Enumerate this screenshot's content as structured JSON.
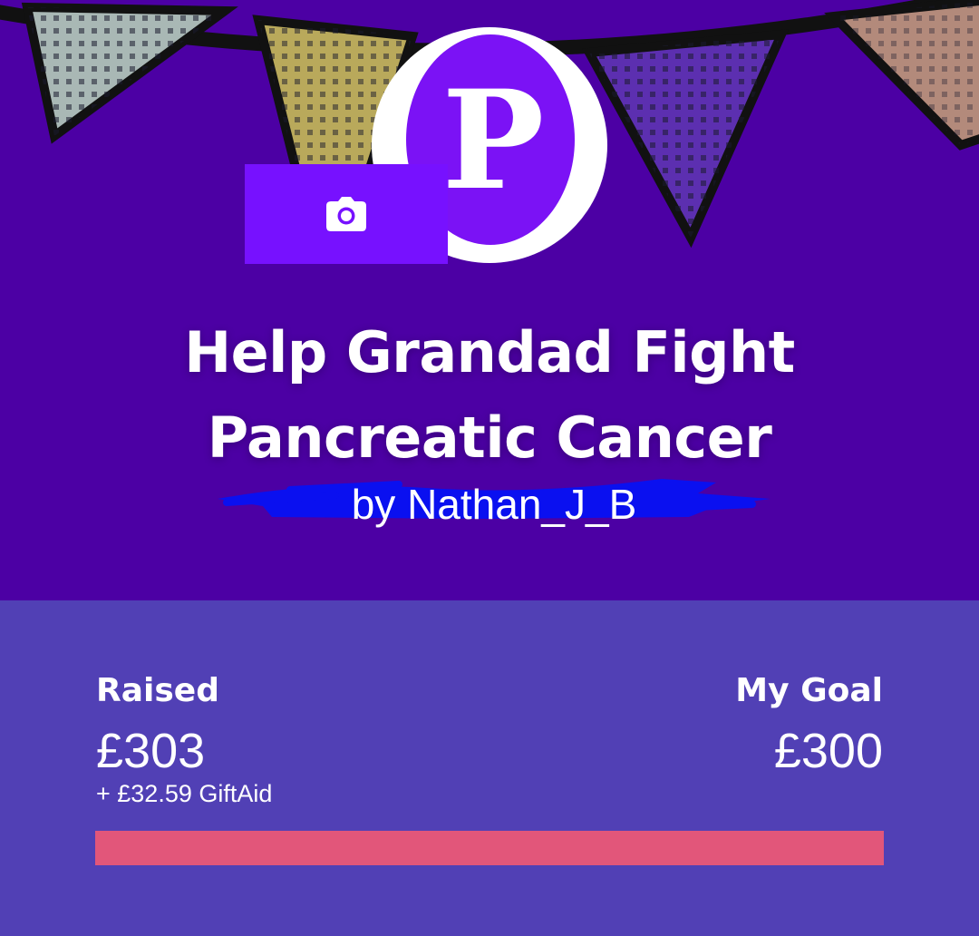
{
  "page": {
    "title_line1": "Help Grandad Fight",
    "title_line2": "Pancreatic Cancer",
    "byline": "by Nathan_J_B"
  },
  "logo": {
    "letter": "P",
    "icon": "charity-logo"
  },
  "camera": {
    "icon": "camera-icon"
  },
  "stats": {
    "raised_label": "Raised",
    "raised_value": "£303",
    "giftaid": "+ £32.59 GiftAid",
    "goal_label": "My Goal",
    "goal_value": "£300",
    "progress_fraction": 1.0
  },
  "colors": {
    "hero_bg": "#4c00a4",
    "stats_bg": "#5140b5",
    "brand_purple": "#7711ff",
    "progress_fill": "#e2567a"
  }
}
